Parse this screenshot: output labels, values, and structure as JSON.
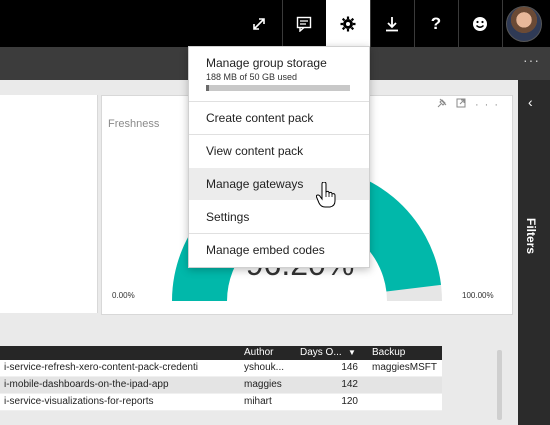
{
  "topbar": {
    "expand_icon": "expand-icon",
    "comment_icon": "comment-icon",
    "settings_icon": "gear-icon",
    "download_icon": "download-icon",
    "help_label": "?",
    "feedback_icon": "smiley-icon",
    "active_color": "#ffffff",
    "bar_color": "#000000"
  },
  "subbar": {
    "more_label": "···"
  },
  "settings_menu": {
    "storage_title": "Manage group storage",
    "storage_subtitle": "188 MB of 50 GB used",
    "storage_used_fraction": 0.004,
    "items": [
      {
        "label": "Create content pack"
      },
      {
        "label": "View content pack"
      },
      {
        "label": "Manage gateways"
      },
      {
        "label": "Settings"
      },
      {
        "label": "Manage embed codes"
      }
    ],
    "hovered_item": "Manage gateways"
  },
  "tile": {
    "title": "Freshness",
    "icons": [
      "pin-icon",
      "focus-icon",
      "more-icon"
    ],
    "gauge_value_text": "96.20%",
    "gauge_min": "0.00%",
    "gauge_max": "100.00%",
    "gauge_fraction": 0.962,
    "gauge_color": "#01b8aa",
    "gauge_track_color": "#e6e6e6"
  },
  "filters": {
    "label": "Filters",
    "chevron": "‹"
  },
  "table": {
    "columns": [
      "Author",
      "Days O...",
      "Backup"
    ],
    "sort_indicator": "▼",
    "rows": [
      {
        "name": "i-service-refresh-xero-content-pack-credenti",
        "author": "yshouk...",
        "days": "146",
        "backup": "maggiesMSFT"
      },
      {
        "name": "i-mobile-dashboards-on-the-ipad-app",
        "author": "maggies",
        "days": "142",
        "backup": ""
      },
      {
        "name": "i-service-visualizations-for-reports",
        "author": "mihart",
        "days": "120",
        "backup": ""
      }
    ]
  }
}
